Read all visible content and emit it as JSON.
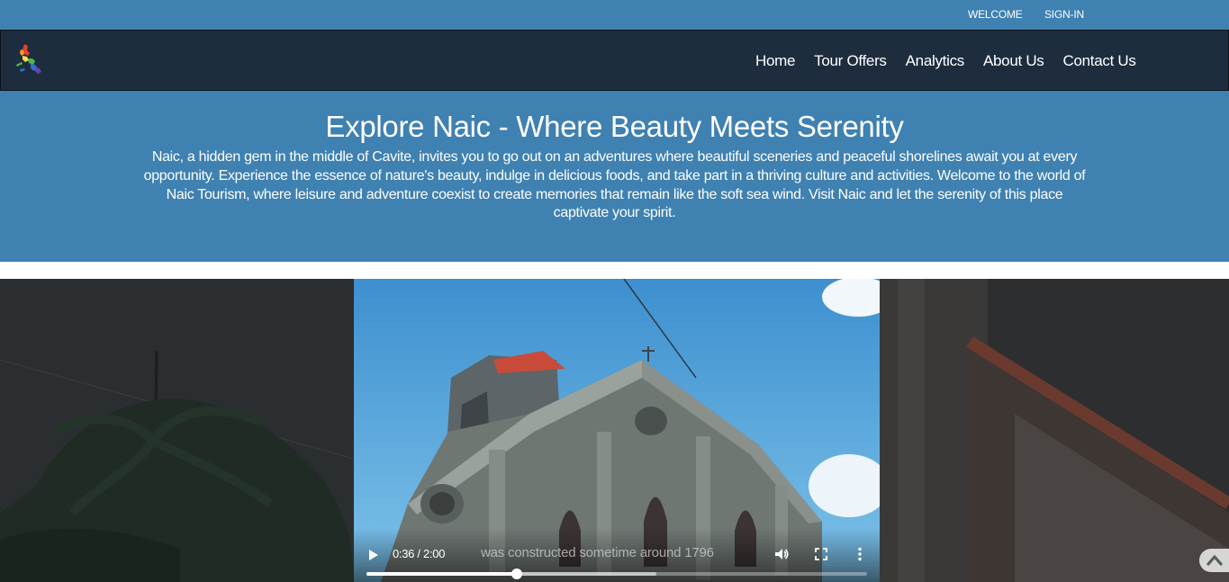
{
  "topbar": {
    "welcome": "WELCOME",
    "signin": "SIGN-IN"
  },
  "nav": {
    "logo_icon": "philippines-map-logo",
    "links": [
      "Home",
      "Tour Offers",
      "Analytics",
      "About Us",
      "Contact Us"
    ]
  },
  "hero": {
    "title": "Explore Naic - Where Beauty Meets Serenity",
    "description": "Naic, a hidden gem in the middle of Cavite, invites you to go out on an adventures where beautiful sceneries and peaceful shorelines await you at every opportunity. Experience the essence of nature's beauty, indulge in delicious foods, and take part in a thriving culture and activities. Welcome to the world of Naic Tourism, where leisure and adventure coexist to create memories that remain like the soft sea wind. Visit Naic and let the serenity of this place captivate your spirit."
  },
  "video": {
    "time": "0:36 / 2:00",
    "caption": "was constructed sometime around 1796",
    "progress_fraction": 0.3,
    "buffered_fraction": 0.58,
    "icons": [
      "play-icon",
      "volume-icon",
      "fullscreen-icon",
      "more-options-icon"
    ]
  },
  "scroll_top": {
    "icon": "chevron-up-icon"
  },
  "colors": {
    "topbar": "#3f81b1",
    "navbar": "#1d2d3d",
    "hero": "#3f81b1",
    "video_bg": "#2a2d2e"
  }
}
